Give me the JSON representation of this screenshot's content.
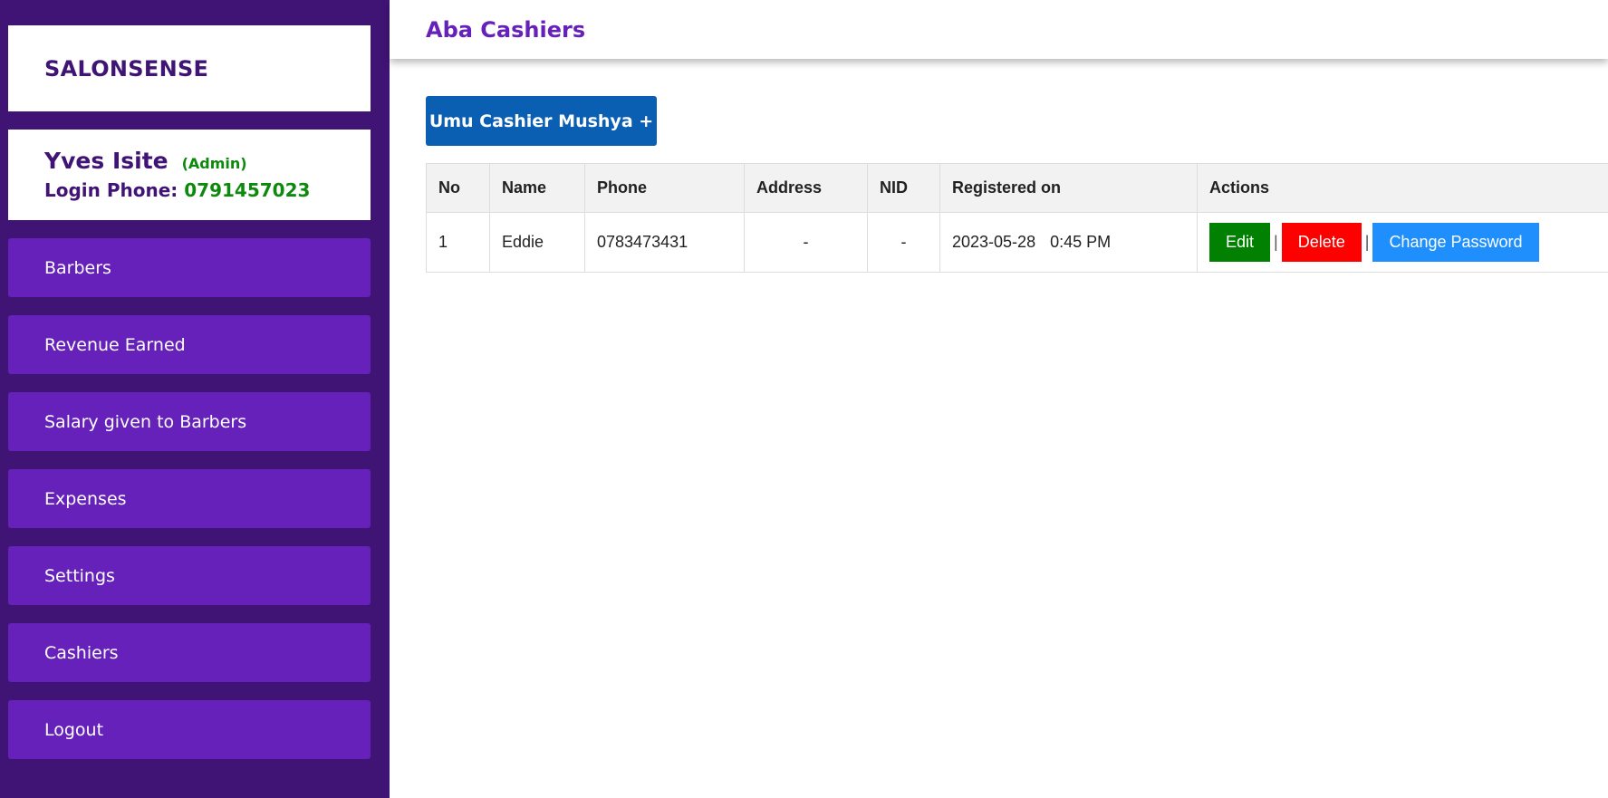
{
  "brand": "SALONSENSE",
  "user": {
    "name": "Yves Isite",
    "role": "(Admin)",
    "phone_label": "Login Phone:",
    "phone": "0791457023"
  },
  "nav": {
    "items": [
      {
        "label": "Barbers"
      },
      {
        "label": "Revenue Earned"
      },
      {
        "label": "Salary given to Barbers"
      },
      {
        "label": "Expenses"
      },
      {
        "label": "Settings"
      },
      {
        "label": "Cashiers"
      },
      {
        "label": "Logout"
      }
    ]
  },
  "page": {
    "title": "Aba Cashiers",
    "add_button": "Umu Cashier Mushya +"
  },
  "table": {
    "columns": [
      "No",
      "Name",
      "Phone",
      "Address",
      "NID",
      "Registered on",
      "Actions"
    ],
    "rows": [
      {
        "no": "1",
        "name": "Eddie",
        "phone": "0783473431",
        "address": "-",
        "nid": "-",
        "date": "2023-05-28",
        "time": "0:45 PM",
        "actions": {
          "edit": "Edit",
          "delete": "Delete",
          "change_password": "Change Password",
          "separator": "|"
        }
      }
    ]
  },
  "colors": {
    "sidebar_bg": "#401475",
    "nav_item_bg": "#6521b9",
    "accent_green": "#0d8a0d",
    "add_button_bg": "#0b5fb3",
    "edit_bg": "#018001",
    "delete_bg": "#fd0000",
    "change_password_bg": "#1e8ffd"
  }
}
